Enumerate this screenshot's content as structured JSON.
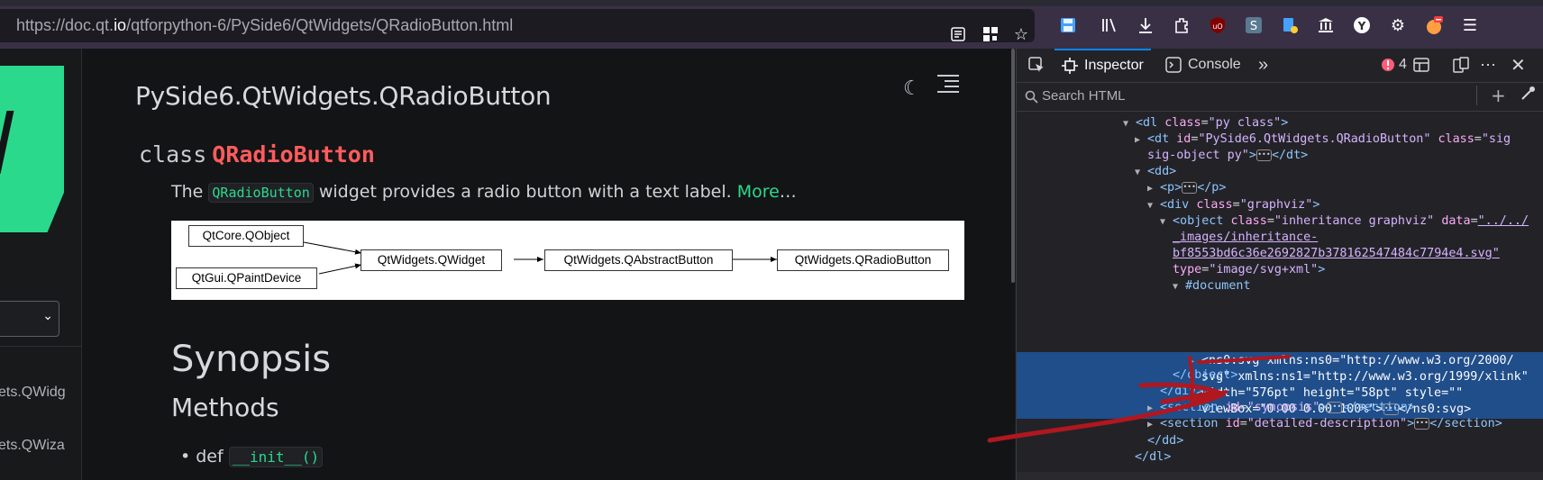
{
  "browser": {
    "url_prefix": "https://doc.qt.",
    "url_domain": "io",
    "url_path": "/qtforpython-6/PySide6/QtWidgets/QRadioButton.html",
    "toolbar_icons": [
      "reader-icon",
      "qr-icon",
      "bookmark-star-icon",
      "save-icon",
      "library-icon",
      "download-icon",
      "extensions-icon",
      "ublock-icon",
      "s-extension-icon",
      "extension-icon",
      "bank-icon",
      "y-icon",
      "settings-icon",
      "profile-icon",
      "menu-icon"
    ],
    "accent": "#3a3046"
  },
  "sidebar": {
    "links": [
      "ets.QWidg",
      "ets.QWiza"
    ]
  },
  "doc": {
    "title": "PySide6.QtWidgets.QRadioButton",
    "class_keyword": "class",
    "class_name": "QRadioButton",
    "desc_prefix": "The",
    "desc_code": "QRadioButton",
    "desc_text": "widget provides a radio button with a text label.",
    "desc_link": "More",
    "desc_ellipsis": "…",
    "graph": {
      "nodes": [
        "QtCore.QObject",
        "QtGui.QPaintDevice",
        "QtWidgets.QWidget",
        "QtWidgets.QAbstractButton",
        "QtWidgets.QRadioButton"
      ]
    },
    "synopsis": "Synopsis",
    "methods": "Methods",
    "method_keyword": "def",
    "method_code": "__init__()",
    "accent": "#2bd98d",
    "class_color": "#ff5c5c"
  },
  "devtools": {
    "tabs": {
      "inspector": "Inspector",
      "console": "Console"
    },
    "error_count": "4",
    "search_placeholder": "Search HTML",
    "lines": {
      "l1_tag": "<dl",
      "l1_an": "class",
      "l1_av": "\"py class\"",
      "l1_end": ">",
      "l2_tag": "<dt",
      "l2_an1": "id",
      "l2_av1": "\"PySide6.QtWidgets.QRadioButton\"",
      "l2_an2": "class",
      "l2_av2a": "\"sig",
      "l3_av2b": "sig-object py\"",
      "l3_end": ">",
      "l3_close": "</dt>",
      "l4_tag": "<dd>",
      "l5_tag": "<p>",
      "l5_close": "</p>",
      "l6_tag": "<div",
      "l6_an": "class",
      "l6_av": "\"graphviz\"",
      "l6_end": ">",
      "l7_tag": "<object",
      "l7_an1": "class",
      "l7_av1": "\"inheritance graphviz\"",
      "l7_an2": "data",
      "l7_lk1": "\"../../",
      "l8_lk": "_images/inheritance-",
      "l9_lk": "bf8553bd6c36e2692827b378162547484c7794e4.svg\"",
      "l10_an": "type",
      "l10_av": "\"image/svg+xml\"",
      "l10_end": ">",
      "l11": "#document",
      "l12_tag": "<ns0:svg",
      "l12_an": "xmlns:ns0",
      "l12_av": "\"http://www.w3.org/2000/",
      "l13_av": "svg\"",
      "l13_an": "xmlns:ns1",
      "l13_av2": "\"http://www.w3.org/1999/xlink\"",
      "l14_an1": "width",
      "l14_av1": "\"576pt\"",
      "l14_an2": "height",
      "l14_av2": "\"58pt\"",
      "l14_an3": "style",
      "l14_av3": "\"\"",
      "l15_an": "viewBox",
      "l15_av": "\"0.00 0.00 100%\"",
      "l15_end": ">",
      "l15_close": "</ns0:svg>",
      "l16": "</object>",
      "l17": "</div>",
      "l18_tag": "<section",
      "l18_an": "id",
      "l18_av": "\"synopsis\"",
      "l18_end": ">",
      "l18_close": "</section>",
      "l19_tag": "<section",
      "l19_an": "id",
      "l19_av": "\"detailed-description\"",
      "l19_end": ">",
      "l19_close": "</section>",
      "l20": "</dd>",
      "l21": "</dl>"
    },
    "selection_color": "#204e8a",
    "annotation_color": "#b0171f"
  }
}
